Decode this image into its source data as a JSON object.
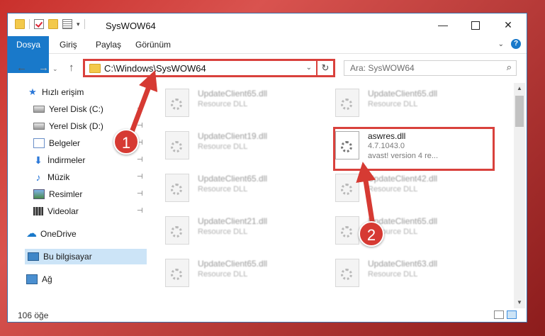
{
  "window": {
    "title": "SysWOW64",
    "controls": {
      "minimize": "—",
      "maximize": "",
      "close": "✕"
    }
  },
  "ribbon": {
    "file_tab": "Dosya",
    "tabs": [
      "Giriş",
      "Paylaş",
      "Görünüm"
    ],
    "expand_glyph": "⌄",
    "help_glyph": "?"
  },
  "nav": {
    "back_glyph": "←",
    "forward_glyph": "→",
    "recent_glyph": "⌄",
    "up_glyph": "↑",
    "address": "C:\\Windows\\SysWOW64",
    "address_dropdown_glyph": "⌄",
    "refresh_glyph": "↻",
    "search_placeholder": "Ara: SysWOW64",
    "search_glyph": "⌕"
  },
  "sidebar": {
    "items": [
      {
        "label": "Hızlı erişim",
        "icon": "star-icon",
        "pinned": false
      },
      {
        "label": "Yerel Disk (C:)",
        "icon": "drive-icon",
        "pinned": true
      },
      {
        "label": "Yerel Disk (D:)",
        "icon": "drive-icon",
        "pinned": true
      },
      {
        "label": "Belgeler",
        "icon": "documents-icon",
        "pinned": true
      },
      {
        "label": "İndirmeler",
        "icon": "download-icon",
        "pinned": true
      },
      {
        "label": "Müzik",
        "icon": "music-icon",
        "pinned": true
      },
      {
        "label": "Resimler",
        "icon": "pictures-icon",
        "pinned": true
      },
      {
        "label": "Videolar",
        "icon": "videos-icon",
        "pinned": true
      },
      {
        "label": "OneDrive",
        "icon": "cloud-icon",
        "pinned": false
      },
      {
        "label": "Bu bilgisayar",
        "icon": "computer-icon",
        "pinned": false,
        "selected": true
      },
      {
        "label": "Ağ",
        "icon": "network-icon",
        "pinned": false
      }
    ],
    "pin_glyph": "📌"
  },
  "files": [
    {
      "name": "UpdateClient65.dll",
      "desc": "Resource DLL"
    },
    {
      "name": "UpdateClient65.dll",
      "desc": "Resource DLL"
    },
    {
      "name": "UpdateClient19.dll",
      "desc": "Resource DLL"
    },
    {
      "name": "aswres.dll",
      "desc": "4.7.1043.0",
      "extra": "avast! version 4 re...",
      "highlighted": true
    },
    {
      "name": "UpdateClient65.dll",
      "desc": "Resource DLL"
    },
    {
      "name": "UpdateClient42.dll",
      "desc": "Resource DLL"
    },
    {
      "name": "UpdateClient21.dll",
      "desc": "Resource DLL"
    },
    {
      "name": "UpdateClient65.dll",
      "desc": "Resource DLL"
    },
    {
      "name": "UpdateClient65.dll",
      "desc": "Resource DLL"
    },
    {
      "name": "UpdateClient63.dll",
      "desc": "Resource DLL"
    }
  ],
  "status": {
    "item_count": "106 öğe"
  },
  "callouts": [
    {
      "number": "1"
    },
    {
      "number": "2"
    }
  ],
  "colors": {
    "accent": "#1979ca",
    "highlight": "#d9413c",
    "selection": "#cce4f7"
  }
}
